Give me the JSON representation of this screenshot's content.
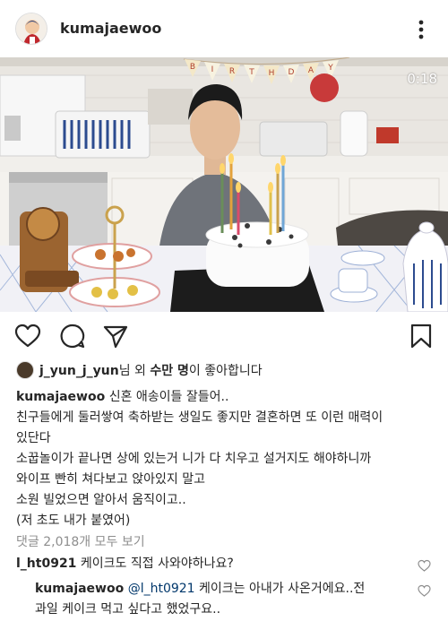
{
  "post": {
    "username": "kumajaewoo",
    "video_timer": "0:18",
    "banner_letters": [
      "B",
      "I",
      "R",
      "T",
      "H",
      "D",
      "A",
      "Y"
    ]
  },
  "likes": {
    "user": "j_yun_j_yun",
    "suffix": "님 외 ",
    "count_text": "수만 명",
    "tail": "이 좋아합니다"
  },
  "caption": {
    "username": "kumajaewoo",
    "lines": [
      "신혼 애송이들 잘들어..",
      "친구들에게 둘러쌓여 축하받는 생일도 좋지만 결혼하면 또 이런 매력이",
      "있단다",
      "소꿉놀이가 끝나면 상에 있는거 니가 다 치우고 설거지도 해야하니까",
      "와이프 빤히 쳐다보고 앉아있지 말고",
      "소원 빌었으면 알아서 움직이고..",
      "(저 초도 내가 붙였어)"
    ]
  },
  "comments": {
    "view_all": "댓글 2,018개 모두 보기",
    "items": [
      {
        "username": "l_ht0921",
        "text": "케이크도 직접 사와야하나요?"
      },
      {
        "username": "kumajaewoo",
        "mention": "@l_ht0921",
        "text_line1": "케이크는 아내가 사온거에요..전",
        "text_line2": "과일 케이크 먹고 싶다고 했었구요.."
      }
    ]
  },
  "colors": {
    "mention": "#00376b",
    "muted": "#8e8e8e",
    "text": "#262626"
  }
}
